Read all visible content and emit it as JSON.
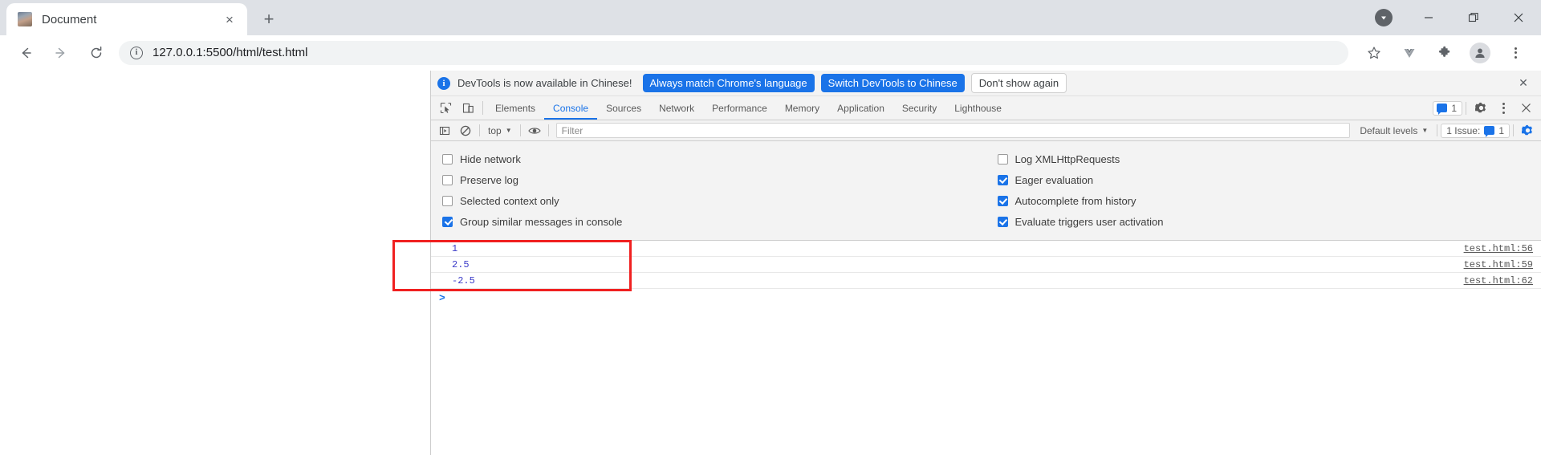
{
  "browser": {
    "tab": {
      "title": "Document",
      "favicon": "page-thumbnail-icon",
      "close_label": "×"
    },
    "new_tab_label": "+",
    "window_controls": {
      "download": "▼",
      "minimize": "—",
      "maximize": "❐",
      "close": "✕"
    },
    "nav": {
      "back": "←",
      "forward": "→",
      "reload": "⟳"
    },
    "omnibox": {
      "info": "i",
      "url": "127.0.0.1:5500/html/test.html"
    },
    "toolbar_right": {
      "bookmark": "☆",
      "vue": "V",
      "extensions": "puzzle",
      "profile": "avatar",
      "menu": "kebab"
    }
  },
  "devtools": {
    "banner": {
      "text": "DevTools is now available in Chinese!",
      "primary": "Always match Chrome's language",
      "secondary": "Switch DevTools to Chinese",
      "dismiss": "Don't show again",
      "close": "✕"
    },
    "tabs": [
      {
        "label": "Elements",
        "active": false
      },
      {
        "label": "Console",
        "active": true
      },
      {
        "label": "Sources",
        "active": false
      },
      {
        "label": "Network",
        "active": false
      },
      {
        "label": "Performance",
        "active": false
      },
      {
        "label": "Memory",
        "active": false
      },
      {
        "label": "Application",
        "active": false
      },
      {
        "label": "Security",
        "active": false
      },
      {
        "label": "Lighthouse",
        "active": false
      }
    ],
    "tabs_right": {
      "message_count": "1",
      "gear": "settings",
      "menu": "more",
      "close": "✕"
    },
    "filterbar": {
      "context": "top",
      "context_caret": "▼",
      "filter_placeholder": "Filter",
      "filter_value": "",
      "levels": "Default levels",
      "levels_caret": "▼",
      "issues": "1 Issue:",
      "issues_count": "1"
    },
    "settings": {
      "left": [
        {
          "label": "Hide network",
          "checked": false
        },
        {
          "label": "Preserve log",
          "checked": false
        },
        {
          "label": "Selected context only",
          "checked": false
        },
        {
          "label": "Group similar messages in console",
          "checked": true
        }
      ],
      "right": [
        {
          "label": "Log XMLHttpRequests",
          "checked": false
        },
        {
          "label": "Eager evaluation",
          "checked": true
        },
        {
          "label": "Autocomplete from history",
          "checked": true
        },
        {
          "label": "Evaluate triggers user activation",
          "checked": true
        }
      ]
    },
    "console_messages": [
      {
        "value": "1",
        "source": "test.html:56"
      },
      {
        "value": "2.5",
        "source": "test.html:59"
      },
      {
        "value": "-2.5",
        "source": "test.html:62"
      }
    ],
    "prompt": ">",
    "annotation_color": "#f02020"
  }
}
